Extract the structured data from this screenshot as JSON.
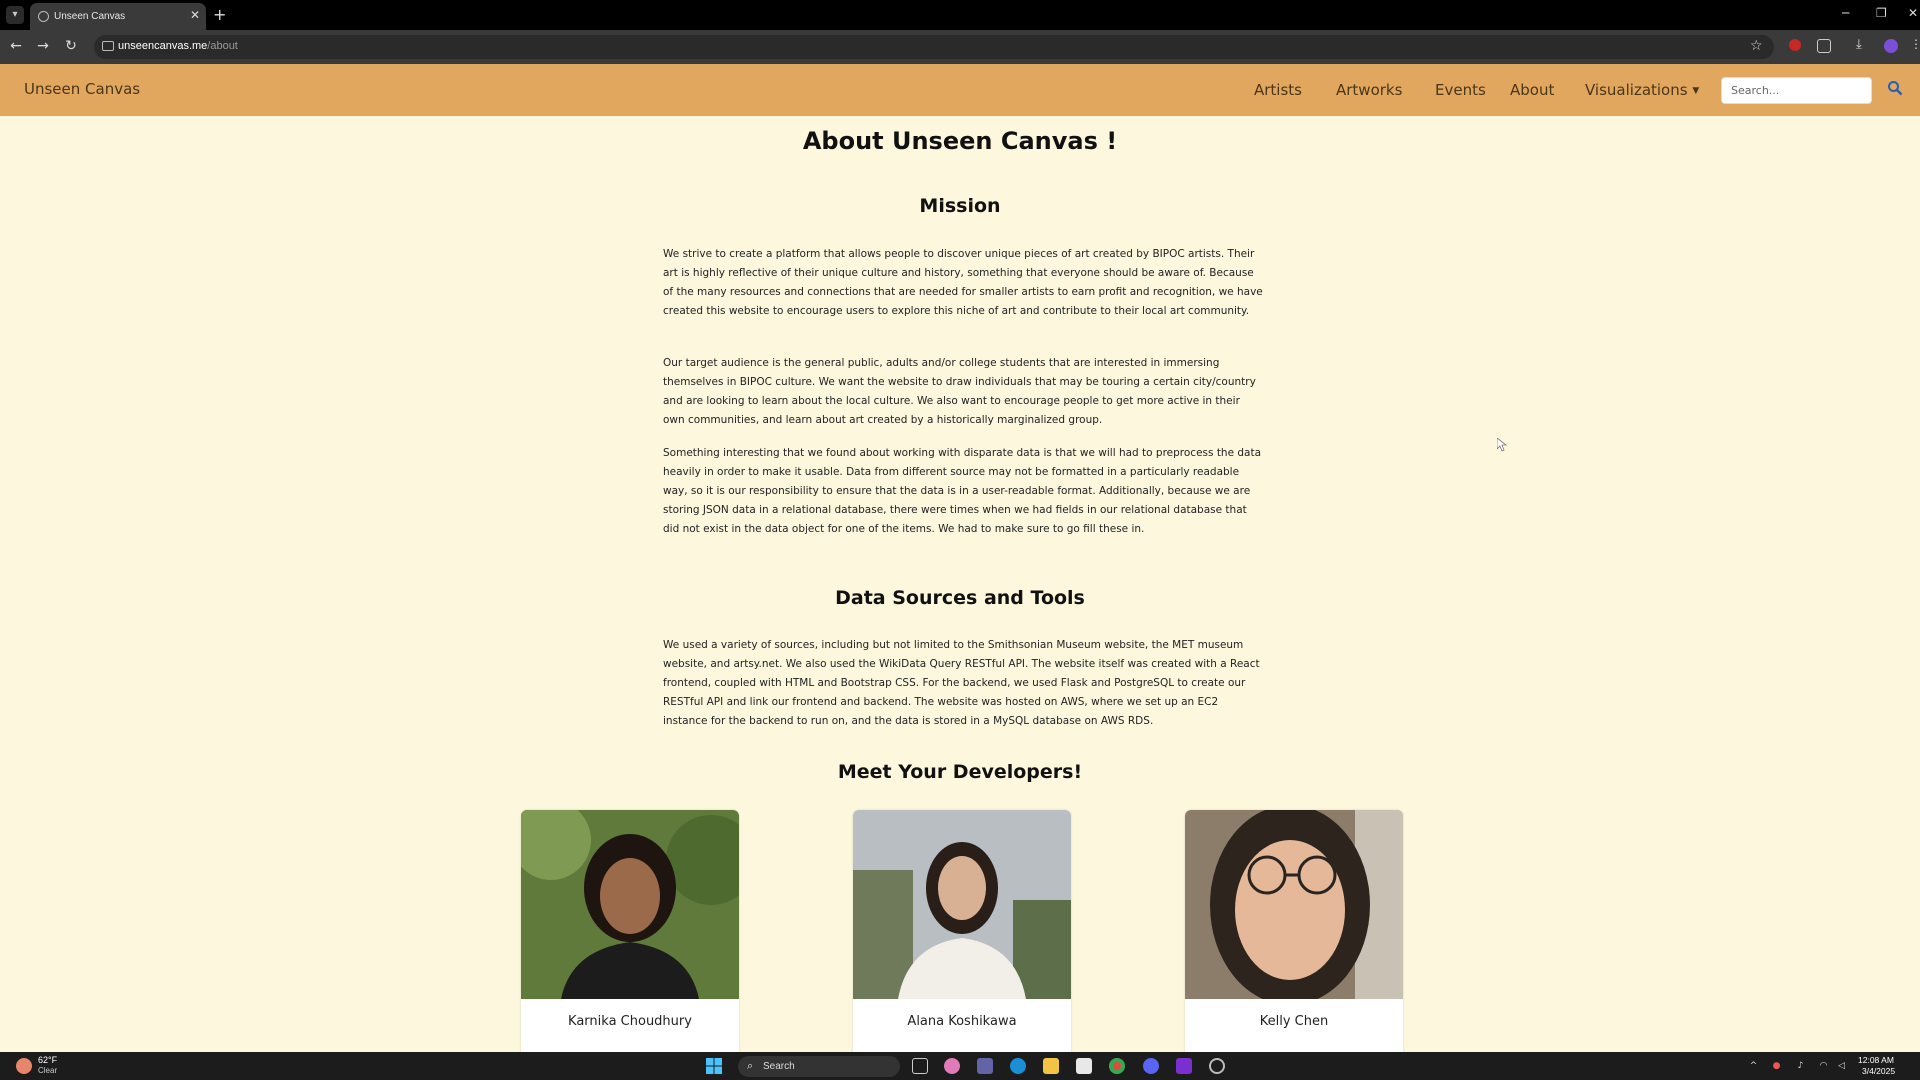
{
  "browser": {
    "tab_title": "Unseen Canvas",
    "url_host": "unseencanvas.me",
    "url_path": "/about",
    "new_tab_label": "+",
    "icons": [
      "tab-search-icon",
      "globe-icon",
      "close-icon",
      "back-arrow-icon",
      "forward-arrow-icon",
      "reload-icon",
      "site-info-icon",
      "star-icon",
      "extension-icon",
      "puzzle-icon",
      "download-icon",
      "profile-icon",
      "kebab-menu-icon"
    ]
  },
  "navbar": {
    "brand": "Unseen Canvas",
    "links": [
      "Artists",
      "Artworks",
      "Events",
      "About",
      "Visualizations"
    ],
    "search_placeholder": "Search...",
    "bg_color": "#e2a75e"
  },
  "main": {
    "title": "About Unseen Canvas !",
    "mission_heading": "Mission",
    "mission_paragraphs": [
      "We strive to create a platform that allows people to discover unique pieces of art created by BIPOC artists. Their art is highly reflective of their unique culture and history, something that everyone should be aware of. Because of the many resources and connections that are needed for smaller artists to earn profit and recognition, we have created this website to encourage users to explore this niche of art and contribute to their local art community.",
      "Our target audience is the general public, adults and/or college students that are interested in immersing themselves in BIPOC culture. We want the website to draw individuals that may be touring a certain city/country and are looking to learn about the local culture. We also want to encourage people to get more active in their own communities, and learn about art created by a historically marginalized group.",
      "Something interesting that we found about working with disparate data is that we will had to preprocess the data heavily in order to make it usable. Data from different source may not be formatted in a particularly readable way, so it is our responsibility to ensure that the data is in a user-readable format. Additionally, because we are storing JSON data in a relational database, there were times when we had fields in our relational database that did not exist in the data object for one of the items. We had to make sure to go fill these in."
    ],
    "sources_heading": "Data Sources and Tools",
    "sources_paragraph": "We used a variety of sources, including but not limited to the Smithsonian Museum website, the MET museum website, and artsy.net. We also used the WikiData Query RESTful API. The website itself was created with a React frontend, coupled with HTML and Bootstrap CSS. For the backend, we used Flask and PostgreSQL to create our RESTful API and link our frontend and backend. The website was hosted on AWS, where we set up an EC2 instance for the backend to run on, and the data is stored in a MySQL database on AWS RDS.",
    "developers_heading": "Meet Your Developers!",
    "developers": [
      {
        "name": "Karnika Choudhury"
      },
      {
        "name": "Alana Koshikawa"
      },
      {
        "name": "Kelly Chen"
      }
    ],
    "page_bg": "#fdf7dd"
  },
  "taskbar": {
    "weather_temp": "62°F",
    "weather_cond": "Clear",
    "search_label": "Search",
    "time": "12:08 AM",
    "date": "3/4/2025"
  }
}
